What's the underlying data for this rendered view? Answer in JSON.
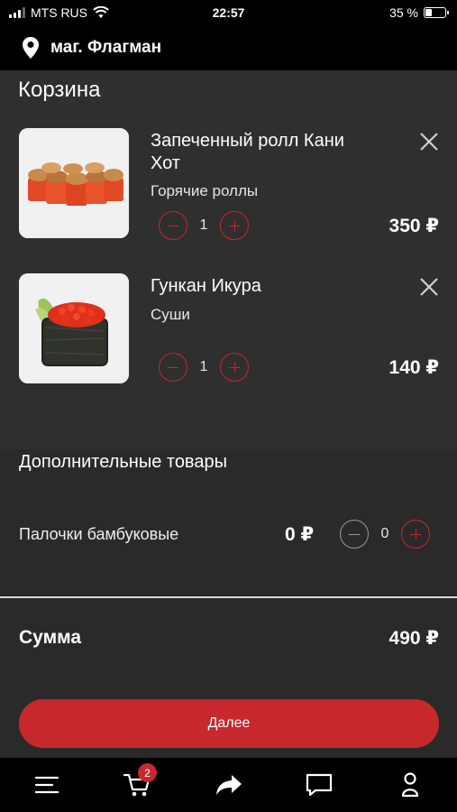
{
  "status_bar": {
    "carrier": "MTS RUS",
    "time": "22:57",
    "battery": "35 %",
    "battery_level": 0.35
  },
  "store": {
    "name": "маг. Флагман"
  },
  "cart": {
    "title": "Корзина",
    "items": [
      {
        "name": "Запеченный ролл Кани Хот",
        "category": "Горячие роллы",
        "quantity": "1",
        "price": "350 ₽",
        "image": "baked-roll-photo"
      },
      {
        "name": "Гункан Икура",
        "category": "Суши",
        "quantity": "1",
        "price": "140 ₽",
        "image": "gunkan-ikura-photo"
      }
    ]
  },
  "extras": {
    "title": "Дополнительные товары",
    "items": [
      {
        "name": "Палочки бамбуковые",
        "price": "0 ₽",
        "quantity": "0"
      }
    ]
  },
  "summary": {
    "label": "Сумма",
    "total": "490 ₽"
  },
  "actions": {
    "next_label": "Далее"
  },
  "bottom_nav": {
    "items": [
      {
        "icon": "menu-icon"
      },
      {
        "icon": "cart-icon",
        "badge": "2"
      },
      {
        "icon": "share-icon"
      },
      {
        "icon": "chat-icon"
      },
      {
        "icon": "profile-icon"
      }
    ]
  },
  "colors": {
    "accent": "#c7282d",
    "background": "#2a2a2a",
    "bar": "#000000"
  }
}
